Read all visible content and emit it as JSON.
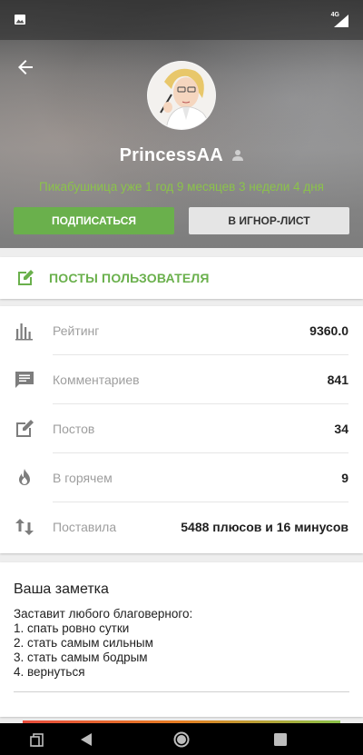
{
  "statusbar": {
    "network_label": "4G",
    "icons": [
      "image-icon",
      "signal-icon"
    ]
  },
  "header": {
    "back_icon": "arrow-left-icon",
    "username": "PrincessAA",
    "badge_icon": "user-badge-icon",
    "since_text": "Пикабушница уже 1 год 9 месяцев 3 недели 4 дня",
    "subscribe_label": "ПОДПИСАТЬСЯ",
    "ignore_label": "В ИГНОР-ЛИСТ"
  },
  "posts_link": {
    "icon": "edit-icon",
    "label": "ПОСТЫ ПОЛЬЗОВАТЕЛЯ"
  },
  "stats": [
    {
      "icon": "rating-bars-icon",
      "label": "Рейтинг",
      "value": "9360.0"
    },
    {
      "icon": "comment-icon",
      "label": "Комментариев",
      "value": "841"
    },
    {
      "icon": "edit-icon",
      "label": "Постов",
      "value": "34"
    },
    {
      "icon": "fire-icon",
      "label": "В горячем",
      "value": "9"
    },
    {
      "icon": "sort-arrows-icon",
      "label": "Поставила",
      "value": "5488 плюсов и 16 минусов"
    }
  ],
  "note": {
    "title": "Ваша заметка",
    "text": "Заставит любого благоверного:\n1. спать ровно сутки\n2. стать самым сильным\n3. стать самым бодрым\n4. вернуться"
  },
  "colors": {
    "accent_green": "#6ab04c",
    "since_green": "#8bc34a",
    "ignore_button_bg": "#e5e5e5"
  },
  "navbar": {
    "icons": [
      "recents-icon",
      "back-triangle-icon",
      "home-circle-icon",
      "overview-square-icon"
    ]
  }
}
